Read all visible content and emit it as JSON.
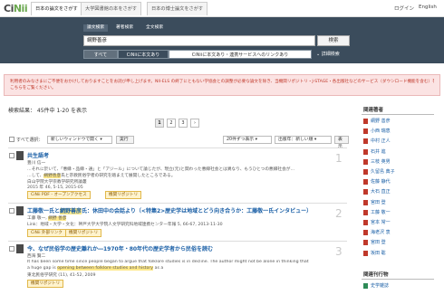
{
  "top": {
    "logo_main": "Ci",
    "logo_ii": "Nii",
    "tabs": [
      "日本の論文をさがす",
      "大学図書館の本をさがす",
      "日本の博士論文をさがす"
    ],
    "login": "ログイン",
    "lang": "English"
  },
  "search": {
    "tabs": [
      "論文検索",
      "著者検索",
      "全文検索"
    ],
    "query": "網野善彦",
    "button": "検索",
    "filters": [
      "すべて",
      "CiNiiに本文あり",
      "CiNiiに本文あり・連携サービスへのリンクあり"
    ],
    "advanced": "詳細検索"
  },
  "notice": {
    "line1": "利用者のみなさまにご不便をおかけしておりますことをお詫び申し上げます。NII-ELS の終了にともない学協会との調整が必要な論文を除き、当機関リポジトリ・J-STAGE・各出版社などのサービス（ダウンロード機能を含む）を再開しました。詳細については",
    "line2": "こちらをご覧ください。"
  },
  "results_summary": "検索結果： 45件中 1-20 を表示",
  "pagination": [
    "1",
    "2",
    "3",
    "›"
  ],
  "controls": {
    "select_all": "すべて選択：",
    "open_mode": "新しいウィンドウで開く",
    "run": "実行",
    "per_page": "20件ずつ表示",
    "sort": "出版年：新しい順",
    "show": "表示"
  },
  "results": [
    {
      "title": "共生語考",
      "author": "豊川 信一",
      "snippet": "…それに於いて、「悪縁・品縁・通」と「アジール」について論じたが、現立(元)と関わった悪縁社会とは異なり、もうひとつの悪縁社会が…",
      "snippet2_pre": "…して、",
      "snippet2_hl": "網野善彦",
      "snippet2_post": "氏と宗教民俗学者の研究を踏まえて展開したところである。",
      "journal": "白山学院大学宗教学研究所論叢",
      "detail": "2015 年 46, 5-15, 2015-05",
      "links": [
        "CiNii PDF - オープンアクセス",
        "機関リポジトリ"
      ],
      "number": "1"
    },
    {
      "title_pre": "工藤敬一氏と",
      "title_hl": "網野善彦",
      "title_post": "氏：休田中の会話より（<特集2>歴史学は地域とどう向き合うか：工藤敬一氏インタビュー）",
      "author_pre": "工藤 敬一, ",
      "author_hl": "網野 善彦",
      "journal": "Link：地域・大学・文化：神戸大学大学院人文学研究科地域連携センター年報 5, 66-67, 2013-11-30",
      "links": [
        "CiNii 外部リンク",
        "機関リポジトリ"
      ],
      "number": "2"
    },
    {
      "title": "今、なぜ民俗学の歴史離れか―1970年・80年代の歴史学者から民俗を読む",
      "author": "西海 賢二",
      "snippet": "It has been some time since people began to argue that folklore studies is in decline. The author might not be alone in thinking that",
      "snippet2_pre": "a huge gap is ",
      "snippet2_hl": "opening between folklore studies and history",
      "snippet2_post": " as a",
      "journal": "東北民俗学研究 (11), 41-52, 2009",
      "links": [
        "機関リポジトリ"
      ],
      "number": "3"
    }
  ],
  "sidebar": {
    "heading": "関連著者",
    "authors": [
      "網野 善彦",
      "小西 瑞恵",
      "中村 正人",
      "石井 進",
      "三枝 英男",
      "久留島 典子",
      "佐藤 静代",
      "大石 直正",
      "宮田 登",
      "工藤 敬一",
      "宮本 常一",
      "海老沢 衷",
      "宮田 登",
      "坂田 聡"
    ],
    "heading2": "関連刊行物",
    "journals": [
      "史学雑誌"
    ]
  }
}
